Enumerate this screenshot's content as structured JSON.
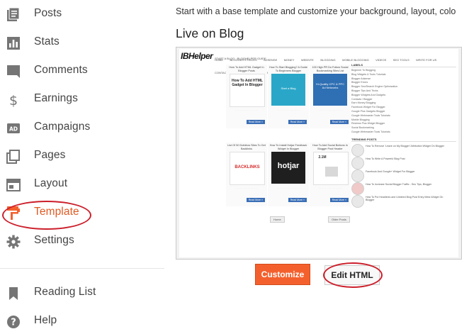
{
  "sidebar": {
    "items": [
      {
        "label": "Posts",
        "icon": "posts-icon"
      },
      {
        "label": "Stats",
        "icon": "stats-icon"
      },
      {
        "label": "Comments",
        "icon": "comments-icon"
      },
      {
        "label": "Earnings",
        "icon": "dollar-icon"
      },
      {
        "label": "Campaigns",
        "icon": "ad-icon"
      },
      {
        "label": "Pages",
        "icon": "pages-icon"
      },
      {
        "label": "Layout",
        "icon": "layout-icon"
      },
      {
        "label": "Template",
        "icon": "template-icon"
      },
      {
        "label": "Settings",
        "icon": "gear-icon"
      }
    ],
    "secondary": [
      {
        "label": "Reading List",
        "icon": "bookmark-icon"
      },
      {
        "label": "Help",
        "icon": "help-icon"
      }
    ],
    "active_color": "#e05a23"
  },
  "main": {
    "intro": "Start with a base template and customize your background, layout, colo",
    "live_title": "Live on Blog",
    "customize_label": "Customize",
    "edit_html_label": "Edit HTML"
  },
  "preview": {
    "logo": "IBHelper",
    "nav": [
      "HOME",
      "BLOGGER ETRICKS",
      "ADSENSE",
      "MONEY",
      "WEBSITE",
      "BLOGGING",
      "MOBILE BLOGGING",
      "VIDEOS",
      "SEO TOOLS",
      "WRITE FOR US",
      "CONTACT",
      "SITEMAP",
      "BLOGGER SEO"
    ],
    "subnav": "START A BLOG · BLOGHELPER GUIDE",
    "posts": [
      {
        "title": "How To Add HTML Gadget In Blogger Posts",
        "thumb_text": "How To Add HTML Gadget In Blogger"
      },
      {
        "title": "How To Start Blogging? A Guide To Beginners Blogger",
        "thumb_text": "Start a Blog"
      },
      {
        "title": "100 High PR Do Follow Social Bookmarking Sites List",
        "thumb_text": "Hi-Quality CPC & PPC Ad Networks"
      },
      {
        "title": "List Of 50 Dofollow Sites To Get Backlinks",
        "thumb_text": "BACKLINKS"
      },
      {
        "title": "How To Install Hotjar Feedback Widget In Blogger",
        "thumb_text": "hotjar"
      },
      {
        "title": "How To Add Social Buttons In Blogger Post Header",
        "thumb_text": "2.1M"
      }
    ],
    "read_more": "Read More »",
    "pager_home": "Home",
    "pager_older": "Older Posts",
    "labels_heading": "LABELS",
    "labels": [
      "Beginner To Blogging",
      "Blog Widgets & Tools Tutorials",
      "Blogger Adsense",
      "Blogger Errors",
      "Blogger Seo/Search Engine Optimization",
      "Blogger Tips And Tricks",
      "Blogger Widgets And Gadgets",
      "Contacts / Blogger",
      "Earn Money Blogging",
      "Facebook Widget For Blogger",
      "Google Plus Gadgets Blogger",
      "Google Webmaster Tools Tutorials",
      "Mobile Blogging",
      "Reviews Plus Widget Blogger",
      "Social Bookmarking",
      "Google Webmaster Tools Tutorials"
    ],
    "trending_heading": "TRENDING POSTS",
    "trending": [
      "How To Remove 'Leave on My Blogger' Attribution Widget On Blogger",
      "How To Write A Powerful Blog Post",
      "Facebook And Google+ Widget For Blogger",
      "How To Increase Social Blogger Traffic - Seo Tips, Blogger",
      "How To Put Headlines and Unbleed Blog Post Entry Meta Widget On Blogger"
    ]
  }
}
